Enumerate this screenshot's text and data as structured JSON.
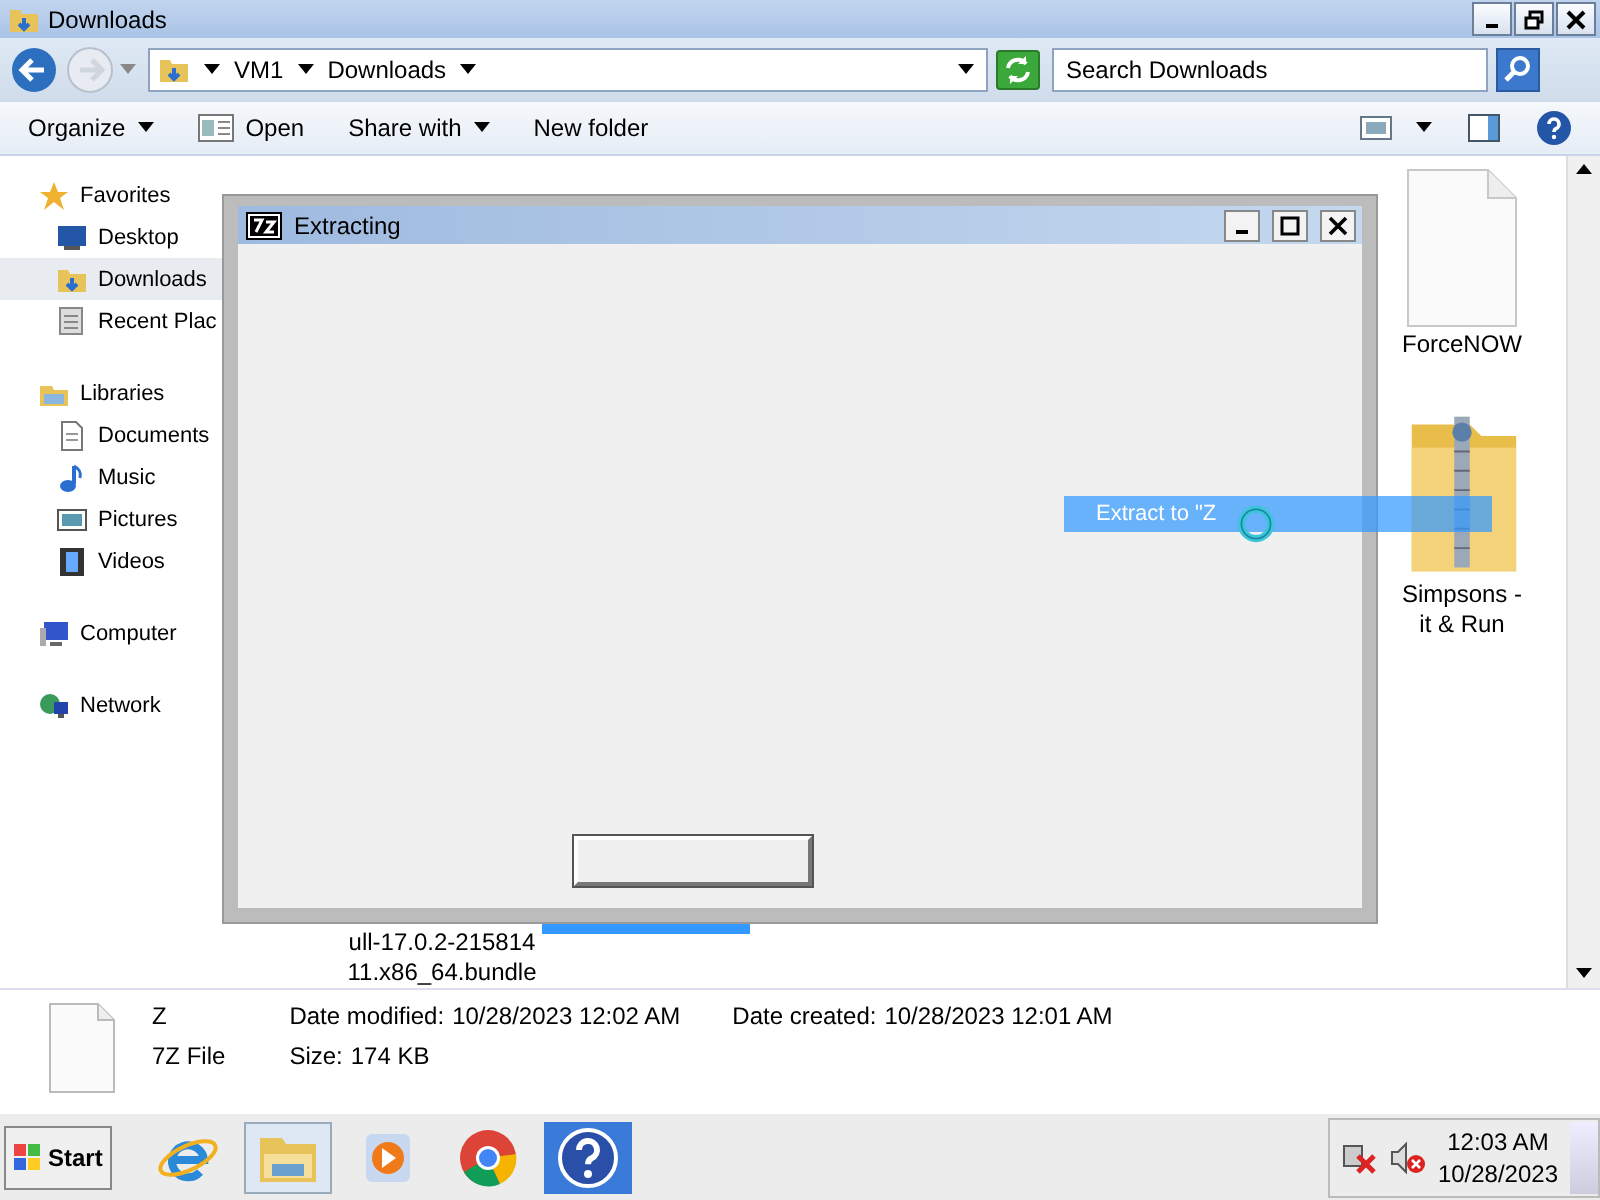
{
  "window": {
    "title": "Downloads"
  },
  "address": {
    "crumbs": [
      "VM1",
      "Downloads"
    ],
    "search_placeholder": "Search Downloads"
  },
  "toolbar": [
    {
      "label": "Organize",
      "dropdown": true
    },
    {
      "label": "Open",
      "dropdown": false,
      "kind": "open"
    },
    {
      "label": "Share with",
      "dropdown": true
    },
    {
      "label": "New folder",
      "dropdown": false
    }
  ],
  "sidebar": {
    "groups": [
      {
        "label": "Favorites",
        "kind": "star",
        "children": [
          {
            "label": "Desktop",
            "kind": "desktop",
            "selected": false
          },
          {
            "label": "Downloads",
            "kind": "downloads",
            "selected": true
          },
          {
            "label": "Recent Plac",
            "kind": "recent",
            "selected": false
          }
        ]
      },
      {
        "label": "Libraries",
        "kind": "library",
        "children": [
          {
            "label": "Documents",
            "kind": "documents",
            "selected": false
          },
          {
            "label": "Music",
            "kind": "music",
            "selected": false
          },
          {
            "label": "Pictures",
            "kind": "pictures",
            "selected": false
          },
          {
            "label": "Videos",
            "kind": "videos",
            "selected": false
          }
        ]
      },
      {
        "label": "Computer",
        "kind": "computer"
      },
      {
        "label": "Network",
        "kind": "network"
      }
    ]
  },
  "files": [
    {
      "lines": [
        "ForceNOW"
      ],
      "kind": "document",
      "selected": false
    },
    {
      "lines": [
        "Simpsons -",
        "it & Run"
      ],
      "kind": "zip",
      "selected": false
    },
    {
      "lines": [
        "ull-17.0.2-215814",
        "11.x86_64.bundle"
      ],
      "kind": "covered",
      "selected": false
    },
    {
      "kind": "covered",
      "selected": true
    }
  ],
  "drag_tooltip": "Extract to \"Z",
  "dialog": {
    "title": "Extracting"
  },
  "details": {
    "name": "Z",
    "type": "7Z File",
    "fields": [
      {
        "label": "Date modified:",
        "value": "10/28/2023 12:02 AM"
      },
      {
        "label": "Date created:",
        "value": "10/28/2023 12:01 AM"
      },
      {
        "label": "Size:",
        "value": "174 KB"
      }
    ]
  },
  "taskbar": {
    "start": "Start",
    "apps": [
      {
        "kind": "ie",
        "selected": false
      },
      {
        "kind": "explorer",
        "selected": true
      },
      {
        "kind": "media",
        "selected": false
      },
      {
        "kind": "chrome",
        "selected": false
      },
      {
        "kind": "help",
        "selected": false
      }
    ],
    "time": "12:03 AM",
    "date": "10/28/2023"
  }
}
